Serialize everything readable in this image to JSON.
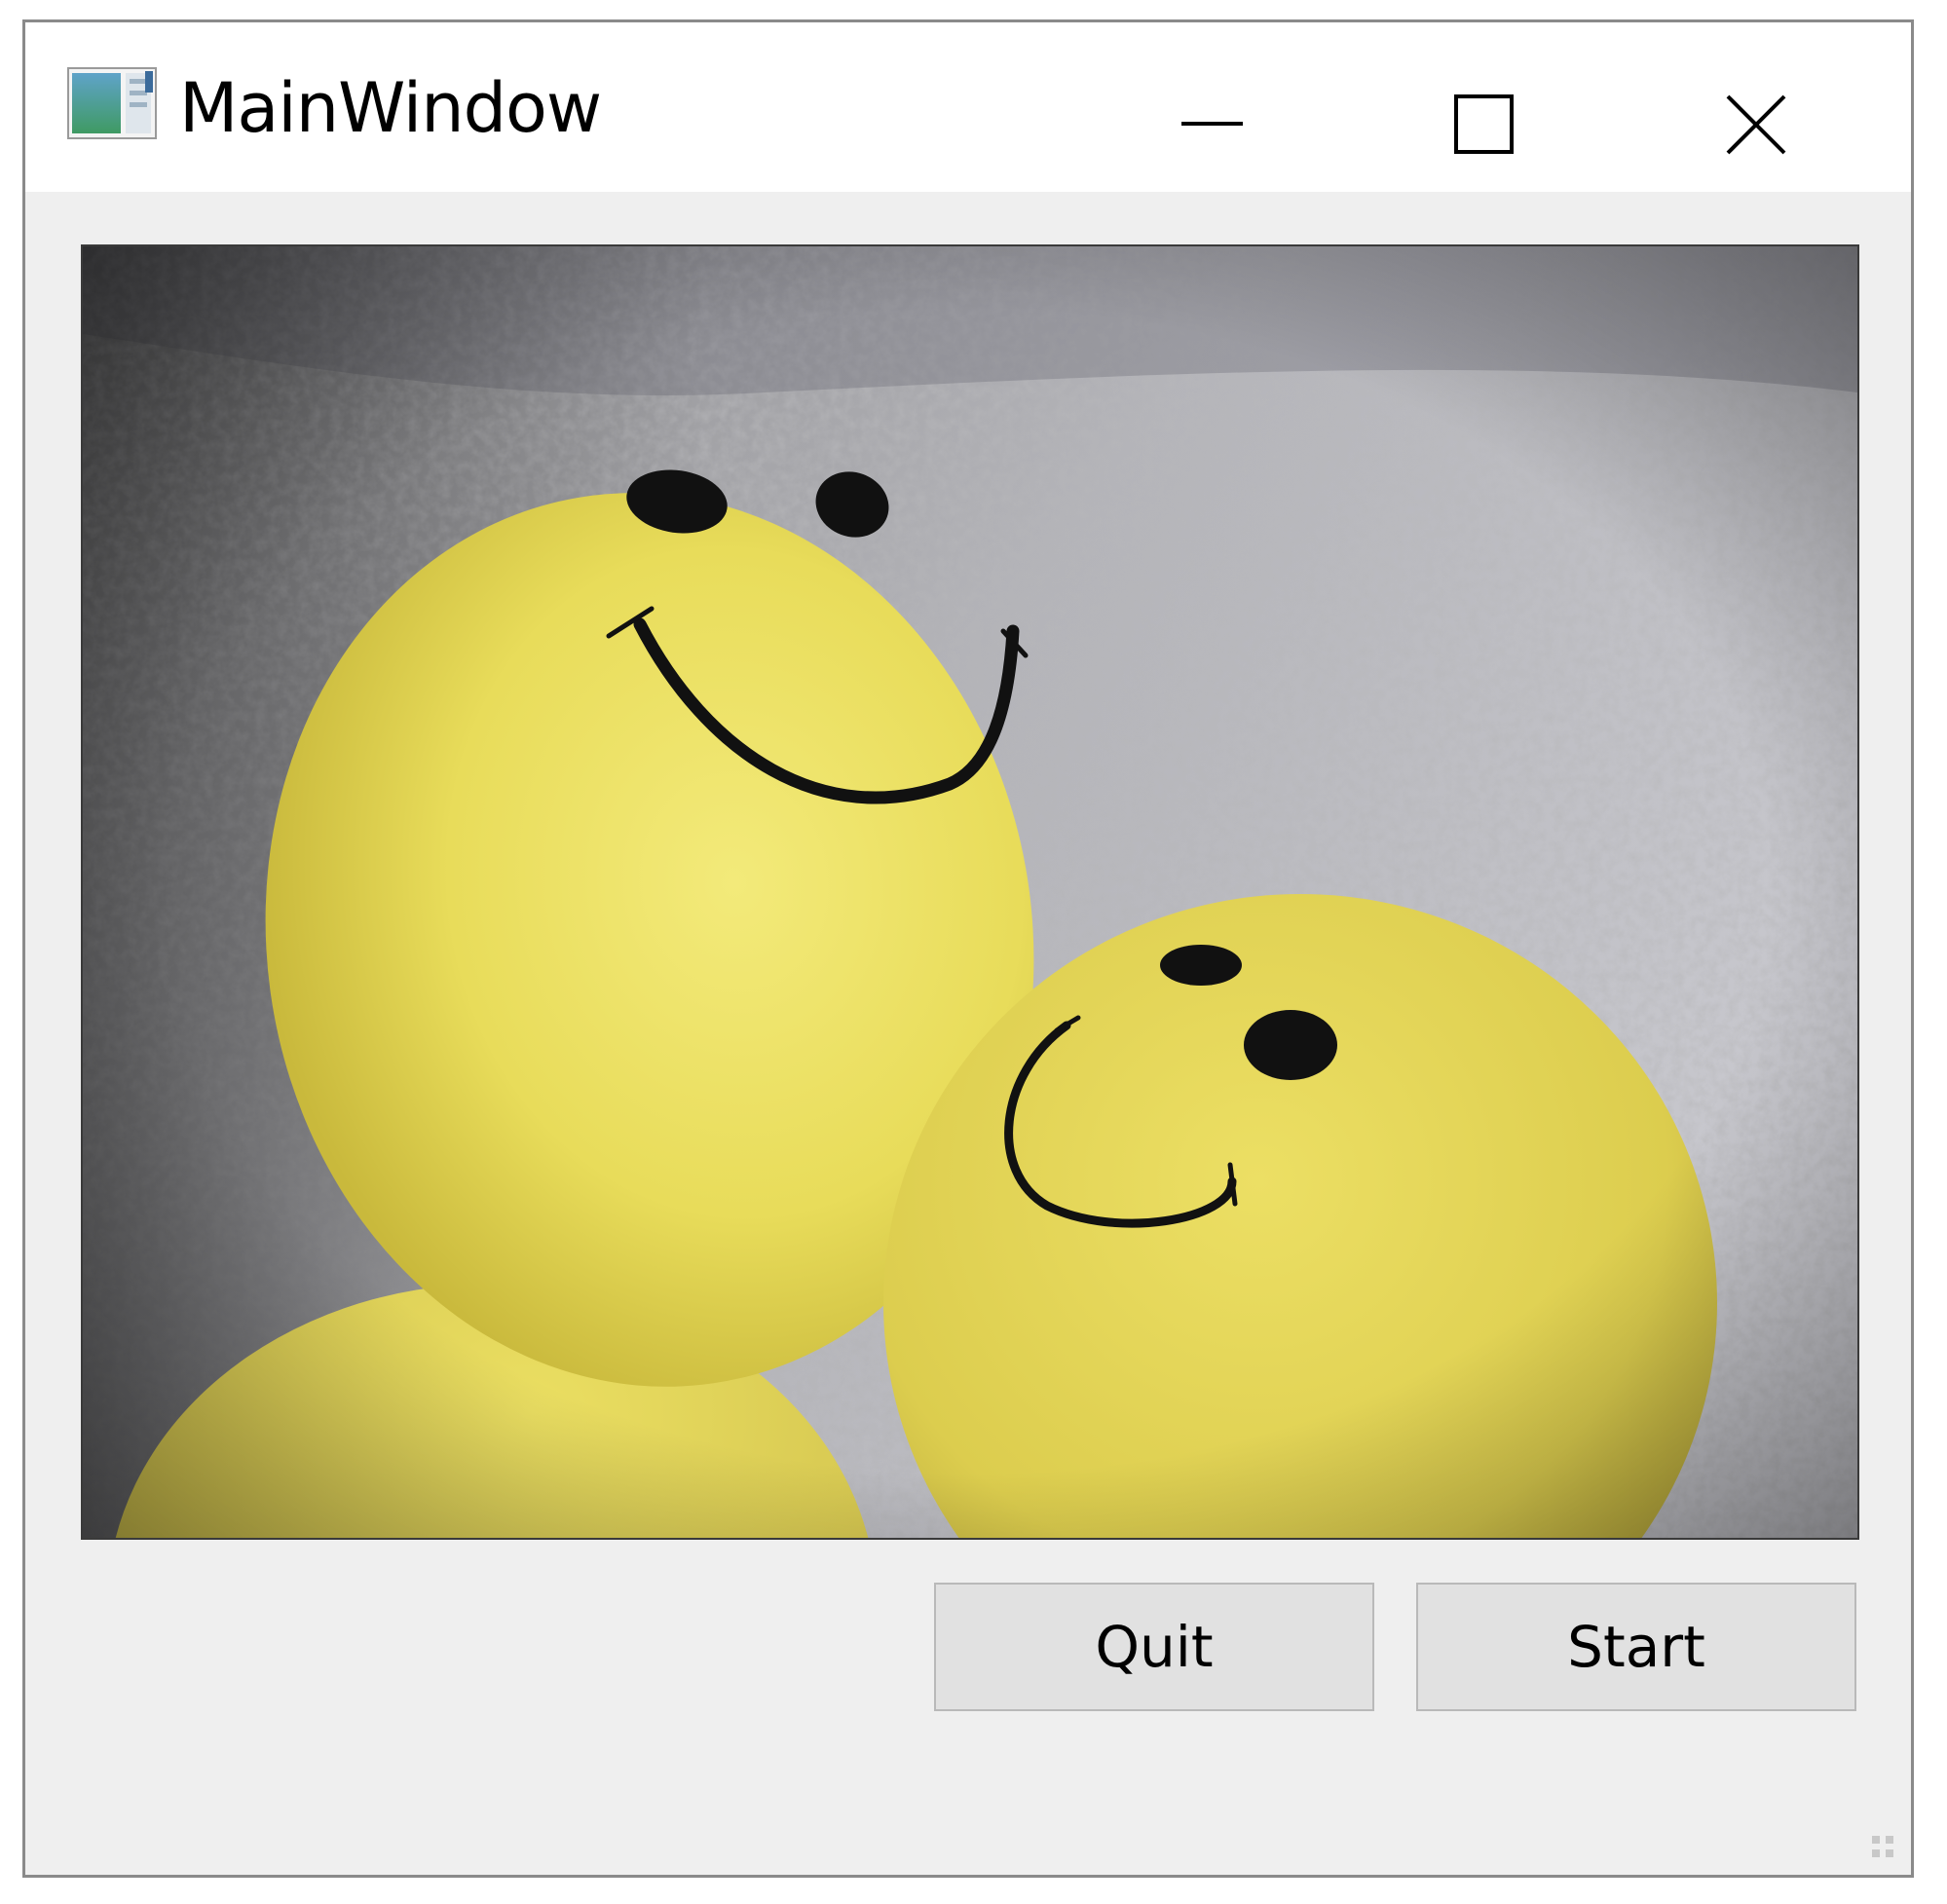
{
  "window": {
    "title": "MainWindow",
    "icon": "app-window-icon"
  },
  "controls": {
    "minimize_icon": "minimize-icon",
    "maximize_icon": "maximize-icon",
    "close_icon": "close-icon"
  },
  "image": {
    "subject": "three yellow smiley-face balloons against a textured gray wall"
  },
  "buttons": {
    "quit_label": "Quit",
    "start_label": "Start"
  },
  "colors": {
    "window_bg": "#efefef",
    "titlebar_bg": "#ffffff",
    "button_bg": "#e1e1e1",
    "balloon_yellow": "#e8dc5a"
  }
}
